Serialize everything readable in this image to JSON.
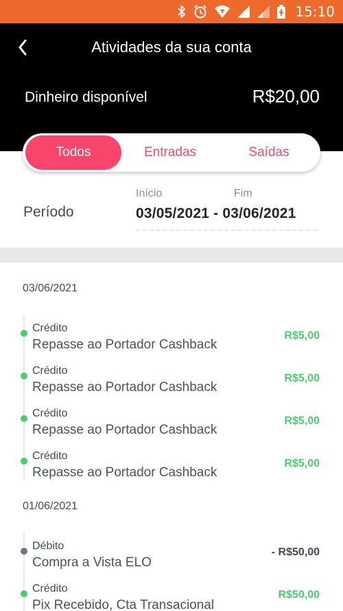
{
  "status_bar": {
    "time": "15:10",
    "icons": [
      "bluetooth-icon",
      "alarm-icon",
      "wifi-icon",
      "signal-icon",
      "signal-weak-icon",
      "battery-icon"
    ],
    "color": "#ee6a2c"
  },
  "header": {
    "title": "Atividades da sua conta",
    "back_icon": "chevron-left-icon",
    "balance_label": "Dinheiro disponível",
    "balance_value": "R$20,00"
  },
  "tabs": [
    {
      "label": "Todos",
      "active": true
    },
    {
      "label": "Entradas",
      "active": false
    },
    {
      "label": "Saídas",
      "active": false
    }
  ],
  "period": {
    "label": "Período",
    "start_label": "Início",
    "end_label": "Fim",
    "range": "03/05/2021 - 03/06/2021"
  },
  "colors": {
    "accent": "#f7456b",
    "credit": "#4ccd6c",
    "debit": "#3f4a5a",
    "debit_dot": "#6b7686"
  },
  "groups": [
    {
      "date": "03/06/2021",
      "transactions": [
        {
          "type": "Crédito",
          "description": "Repasse ao Portador Cashback",
          "amount": "R$5,00",
          "kind": "credit"
        },
        {
          "type": "Crédito",
          "description": "Repasse ao Portador Cashback",
          "amount": "R$5,00",
          "kind": "credit"
        },
        {
          "type": "Crédito",
          "description": "Repasse ao Portador Cashback",
          "amount": "R$5,00",
          "kind": "credit"
        },
        {
          "type": "Crédito",
          "description": "Repasse ao Portador Cashback",
          "amount": "R$5,00",
          "kind": "credit"
        }
      ]
    },
    {
      "date": "01/06/2021",
      "transactions": [
        {
          "type": "Débito",
          "description": "Compra a Vista ELO",
          "amount": "- R$50,00",
          "kind": "debit"
        },
        {
          "type": "Crédito",
          "description": "Pix Recebido, Cta Transacional",
          "amount": "R$50,00",
          "kind": "credit"
        }
      ]
    }
  ]
}
